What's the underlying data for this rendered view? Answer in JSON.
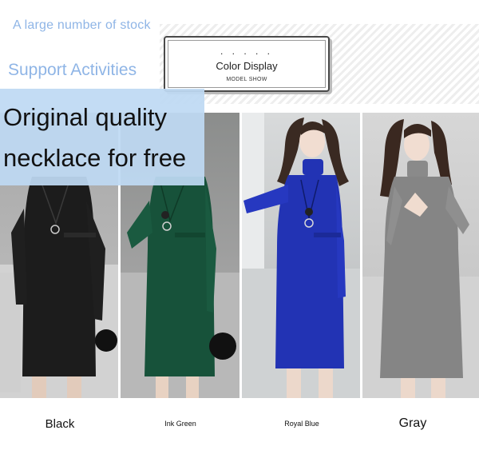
{
  "header": {
    "promo_top": "A large number of stock",
    "promo_mid": "Support Activities"
  },
  "color_card": {
    "dots": ". . . . .",
    "title": "Color Display",
    "subtitle": "MODEL SHOW"
  },
  "promo": {
    "line1": "Original quality",
    "line2": "necklace for free"
  },
  "variants": [
    {
      "label": "Black",
      "color": "#1c1c1c"
    },
    {
      "label": "Ink Green",
      "color": "#17523a"
    },
    {
      "label": "Royal Blue",
      "color": "#2233b4"
    },
    {
      "label": "Gray",
      "color": "#858585"
    }
  ],
  "accent": "#8fb5e6",
  "promo_bg": "#bed9f3"
}
